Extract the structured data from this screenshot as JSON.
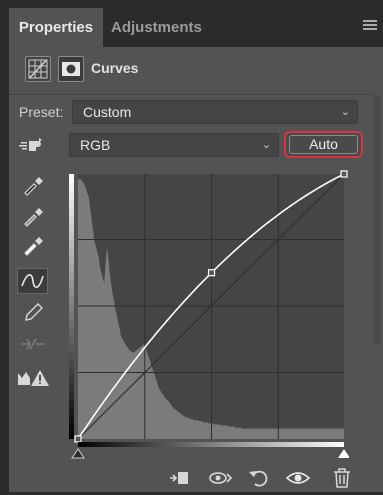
{
  "tabs": [
    {
      "label": "Properties",
      "active": true
    },
    {
      "label": "Adjustments",
      "active": false
    }
  ],
  "header": {
    "title": "Curves",
    "icon": "curves-adjustment-icon",
    "mask_icon": "layer-mask-icon"
  },
  "preset": {
    "label": "Preset:",
    "value": "Custom"
  },
  "channel": {
    "value": "RGB"
  },
  "auto_button": {
    "label": "Auto"
  },
  "tools": [
    "on-image-adjustment-icon",
    "black-point-eyedropper-icon",
    "gray-point-eyedropper-icon",
    "white-point-eyedropper-icon",
    "curve-points-icon",
    "pencil-draw-icon",
    "smooth-curve-icon",
    "clipping-warning-icon"
  ],
  "curve": {
    "points": [
      [
        0,
        0
      ],
      [
        128,
        160
      ],
      [
        255,
        255
      ]
    ]
  },
  "histogram": [
    250,
    250,
    250,
    248,
    246,
    244,
    240,
    236,
    232,
    220,
    210,
    200,
    190,
    185,
    180,
    175,
    165,
    160,
    155,
    150,
    170,
    185,
    175,
    160,
    150,
    140,
    135,
    125,
    120,
    112,
    108,
    100,
    97,
    95,
    92,
    90,
    88,
    86,
    85,
    84,
    83,
    84,
    85,
    86,
    87,
    88,
    89,
    90,
    92,
    88,
    84,
    80,
    76,
    72,
    68,
    64,
    60,
    56,
    52,
    48,
    46,
    44,
    42,
    40,
    38,
    37,
    36,
    34,
    32,
    30,
    29,
    28,
    27,
    26,
    25,
    24,
    23,
    22,
    21,
    21,
    20,
    20,
    19,
    19,
    18,
    18,
    18,
    18,
    17,
    17,
    17,
    16,
    16,
    16,
    16,
    15,
    15,
    15,
    15,
    14,
    14,
    14,
    14,
    14,
    13,
    13,
    13,
    13,
    13,
    12,
    12,
    12,
    12,
    12,
    11,
    11,
    11,
    11,
    11,
    10,
    10,
    10,
    10,
    10,
    10,
    10,
    10,
    10,
    10,
    10,
    10,
    10,
    10,
    10,
    10,
    10,
    10,
    10,
    10,
    10,
    10,
    10,
    10,
    10,
    10,
    10,
    10,
    10,
    10,
    10,
    10,
    10,
    10,
    10,
    10,
    10,
    10,
    10,
    10,
    10,
    10,
    10,
    10,
    10,
    10,
    10,
    10,
    10,
    10,
    10,
    10,
    10,
    10,
    10,
    10,
    10,
    10,
    10,
    10,
    10,
    10,
    10,
    10,
    10,
    10,
    10,
    10,
    10,
    10,
    10,
    10,
    10,
    10,
    10
  ],
  "bottom_icons": [
    "clip-to-layer-icon",
    "view-previous-state-icon",
    "reset-adjustment-icon",
    "toggle-visibility-icon",
    "delete-adjustment-icon"
  ],
  "colors": {
    "panel": "#535353",
    "highlight": "#d6343f"
  }
}
